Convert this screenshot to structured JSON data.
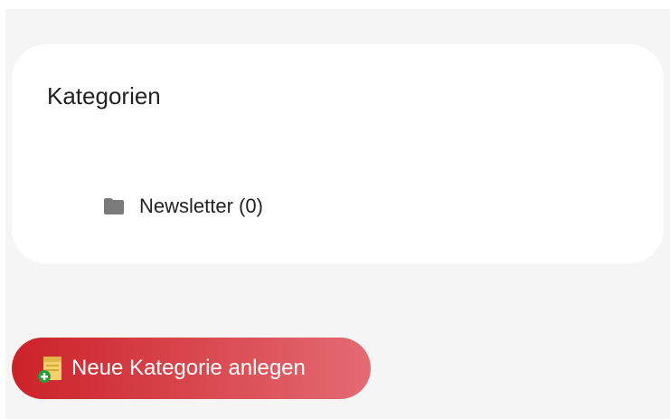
{
  "categories_card": {
    "title": "Kategorien",
    "items": [
      {
        "icon": "folder-icon",
        "label": "Newsletter (0)"
      }
    ]
  },
  "actions": {
    "new_category_label": "Neue Kategorie anlegen",
    "new_category_icon": "add-document-icon"
  },
  "colors": {
    "background": "#f5f5f5",
    "card": "#ffffff",
    "button_start": "#cc2229",
    "button_end": "#e46b72"
  }
}
